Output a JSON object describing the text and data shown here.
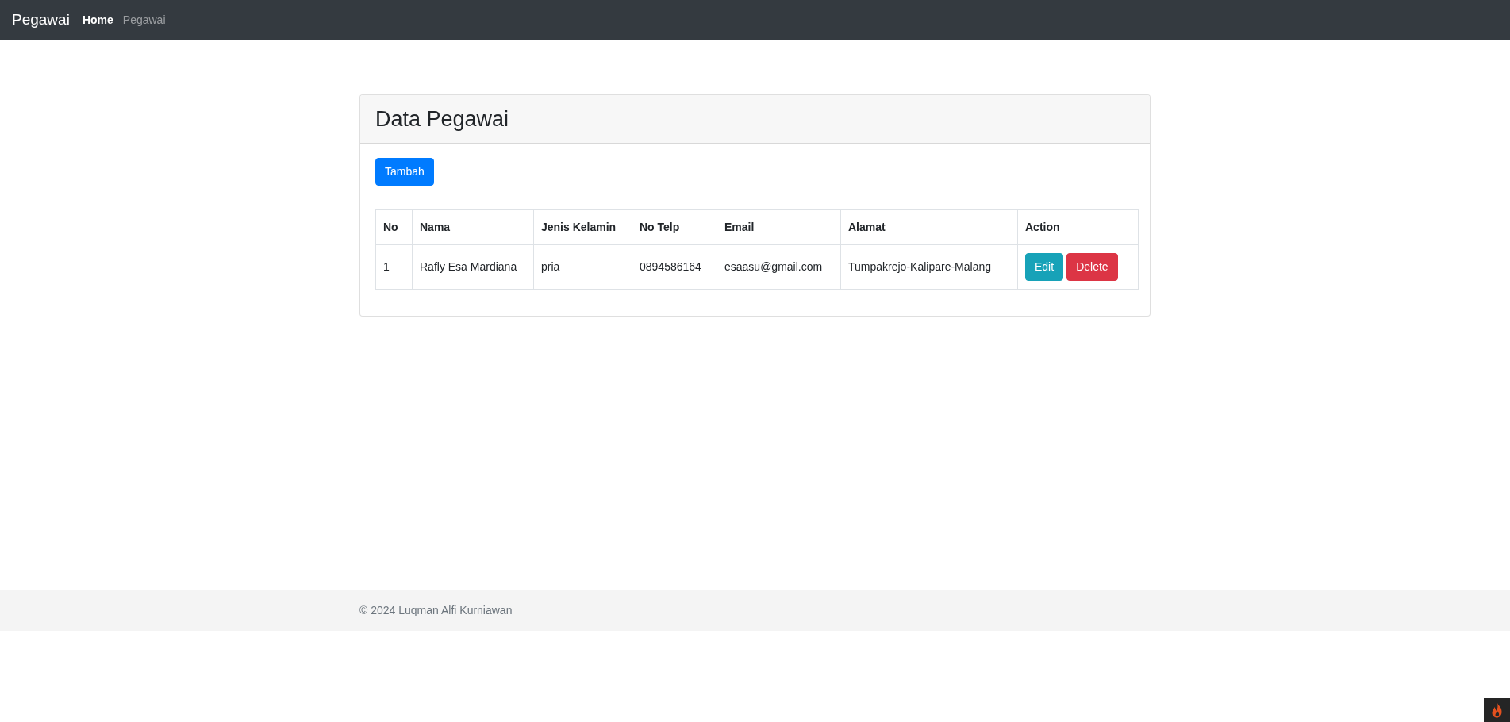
{
  "navbar": {
    "brand": "Pegawai",
    "links": [
      {
        "label": "Home",
        "selected": true
      },
      {
        "label": "Pegawai",
        "selected": false
      }
    ]
  },
  "card": {
    "title": "Data Pegawai",
    "add_button": "Tambah",
    "table": {
      "columns": [
        "No",
        "Nama",
        "Jenis Kelamin",
        "No Telp",
        "Email",
        "Alamat",
        "Action"
      ],
      "rows": [
        {
          "cells": [
            "1",
            "Rafly Esa Mardiana",
            "pria",
            "0894586164",
            "esaasu@gmail.com",
            "Tumpakrejo-Kalipare-Malang"
          ],
          "actions": [
            {
              "label": "Edit",
              "kind": "edit"
            },
            {
              "label": "Delete",
              "kind": "delete"
            }
          ]
        }
      ]
    }
  },
  "footer": {
    "text": "© 2024 Luqman Alfi Kurniawan"
  }
}
